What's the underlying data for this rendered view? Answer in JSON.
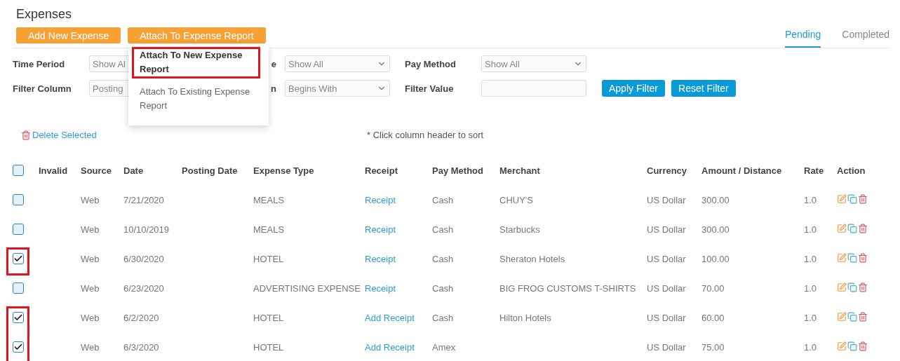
{
  "title": "Expenses",
  "actions": [
    {
      "label": "Add New Expense"
    },
    {
      "label": "Attach To Expense Report"
    }
  ],
  "tabs": [
    {
      "label": "Pending",
      "selected": true
    },
    {
      "label": "Completed",
      "selected": false
    }
  ],
  "filters": [
    {
      "label": "Time Period",
      "kind": "select",
      "value": "Show Al"
    },
    {
      "label": "e",
      "kind": "select",
      "value": "Show All"
    },
    {
      "label": "Pay Method",
      "kind": "select",
      "value": "Show All"
    },
    {
      "label": "Filter Column",
      "kind": "select",
      "value": "Posting"
    },
    {
      "label": "n",
      "kind": "select",
      "value": "Begins With"
    },
    {
      "label": "Filter Value",
      "kind": "input"
    }
  ],
  "filter_buttons": [
    "Apply Filter",
    "Reset Filter"
  ],
  "dropdown_menu": [
    {
      "label": "Attach To New Expense Report",
      "highlighted": true
    },
    {
      "label": "Attach To Existing Expense Report",
      "highlighted": false
    }
  ],
  "delete_selected": "Delete Selected",
  "sort_hint": "* Click column header to sort",
  "table": {
    "all_checked": false,
    "columns": [
      "Invalid",
      "Source",
      "Date",
      "Posting Date",
      "Expense Type",
      "Receipt",
      "Pay Method",
      "Merchant",
      "Currency",
      "Amount / Distance",
      "Rate",
      "Action"
    ],
    "rows": [
      {
        "checked": false,
        "highlighted": false,
        "source": "Web",
        "date": "7/21/2020",
        "expense_type": "MEALS",
        "receipt": "Receipt",
        "pay_method": "Cash",
        "merchant": "CHUY'S",
        "currency": "US Dollar",
        "amount": "300.00",
        "rate": "1.0"
      },
      {
        "checked": false,
        "highlighted": false,
        "source": "Web",
        "date": "10/10/2019",
        "expense_type": "MEALS",
        "receipt": "Receipt",
        "pay_method": "Cash",
        "merchant": "Starbucks",
        "currency": "US Dollar",
        "amount": "300.00",
        "rate": "1.0"
      },
      {
        "checked": true,
        "highlighted": true,
        "source": "Web",
        "date": "6/30/2020",
        "expense_type": "HOTEL",
        "receipt": "Receipt",
        "pay_method": "Cash",
        "merchant": "Sheraton Hotels",
        "currency": "US Dollar",
        "amount": "100.00",
        "rate": "1.0"
      },
      {
        "checked": false,
        "highlighted": false,
        "source": "Web",
        "date": "6/23/2020",
        "expense_type": "ADVERTISING EXPENSE",
        "receipt": "Receipt",
        "pay_method": "Cash",
        "merchant": "BIG FROG CUSTOMS T-SHIRTS",
        "currency": "US Dollar",
        "amount": "70.00",
        "rate": "1.0"
      },
      {
        "checked": true,
        "highlighted": true,
        "source": "Web",
        "date": "6/2/2020",
        "expense_type": "HOTEL",
        "receipt": "Add Receipt",
        "pay_method": "Cash",
        "merchant": "Hilton Hotels",
        "currency": "US Dollar",
        "amount": "60.00",
        "rate": "1.0"
      },
      {
        "checked": true,
        "highlighted": true,
        "source": "Web",
        "date": "6/3/2020",
        "expense_type": "HOTEL",
        "receipt": "Add Receipt",
        "pay_method": "Amex",
        "currency": "US Dollar",
        "amount": "75.00",
        "rate": "1.0"
      }
    ]
  }
}
